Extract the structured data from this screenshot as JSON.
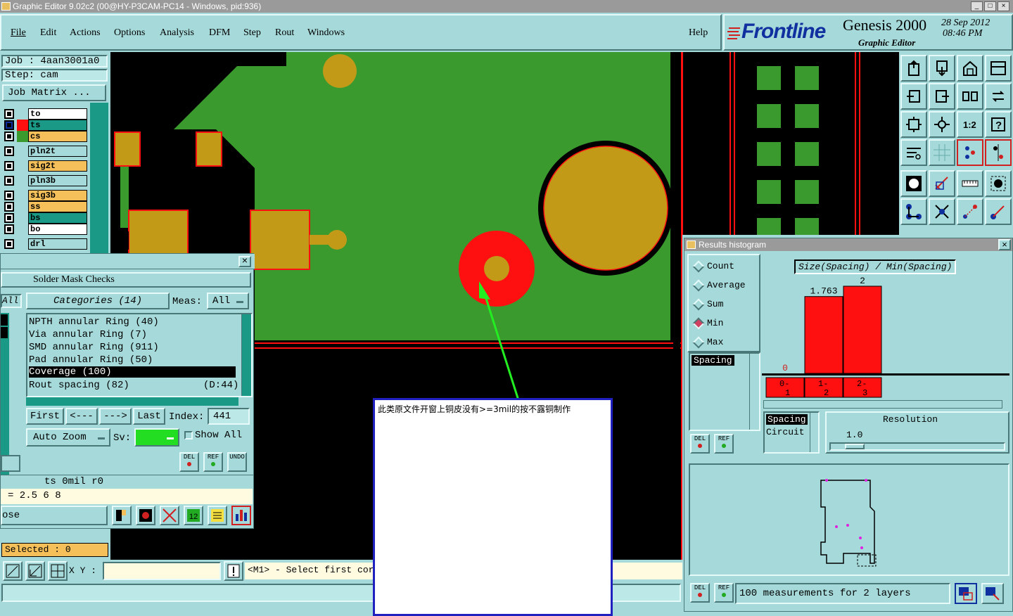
{
  "window": {
    "title": "Graphic Editor 9.02c2 (00@HY-P3CAM-PC14 - Windows, pid:936)"
  },
  "menu": {
    "items": [
      "File",
      "Edit",
      "Actions",
      "Options",
      "Analysis",
      "DFM",
      "Step",
      "Rout",
      "Windows"
    ],
    "help": "Help"
  },
  "brand": {
    "logo": "Frontline",
    "product": "Genesis 2000",
    "subtitle": "Graphic Editor",
    "date": "28 Sep 2012",
    "time": "08:46 PM"
  },
  "job": {
    "job": "Job : 4aan3001a0",
    "step": "Step: cam",
    "matrix_button": "Job Matrix ..."
  },
  "layers": [
    {
      "name": "to",
      "color": "#ffffff"
    },
    {
      "name": "ts",
      "color": "#1a9a86"
    },
    {
      "name": "cs",
      "color": "#f5c05a"
    },
    {
      "name": "pln2t",
      "color": "#a6dada"
    },
    {
      "name": "sig2t",
      "color": "#f5c05a"
    },
    {
      "name": "pln3b",
      "color": "#a6dada"
    },
    {
      "name": "sig3b",
      "color": "#f5c05a"
    },
    {
      "name": "ss",
      "color": "#f5c05a"
    },
    {
      "name": "bs",
      "color": "#1a9a86"
    },
    {
      "name": "bo",
      "color": "#ffffff"
    },
    {
      "name": "drl",
      "color": "#a6dada"
    }
  ],
  "checks": {
    "title": "Solder Mask Checks",
    "all_label": "All",
    "categories": "Categories (14)",
    "meas_label": "Meas:",
    "meas_value": "All",
    "rows": [
      {
        "text": "NPTH annular Ring (40)",
        "extra": ""
      },
      {
        "text": "Via annular Ring (7)",
        "extra": ""
      },
      {
        "text": "SMD annular Ring (911)",
        "extra": ""
      },
      {
        "text": "Pad annular Ring (50)",
        "extra": ""
      },
      {
        "text": "Coverage (100)",
        "extra": ""
      },
      {
        "text": "Rout spacing (82)",
        "extra": "(D:44)"
      }
    ],
    "first": "First",
    "prev": "<---",
    "next": "--->",
    "last": "Last",
    "index_label": "Index:",
    "index_value": "441",
    "auto_zoom": "Auto Zoom",
    "sv": "Sv:",
    "show_all": "Show All",
    "del": "DEL",
    "ref": "REF",
    "undo": "UNDO",
    "info": "ts 0mil r0",
    "values": "= 2.5 6 8",
    "close": "ose"
  },
  "selected": "Selected : 0",
  "status": {
    "xy": "X Y :",
    "prompt": "<M1> - Select first corner"
  },
  "annotation": "此类原文件开窗上铜皮没有>=3mil的按不露铜制作",
  "results": {
    "title": "Results histogram",
    "modes": [
      "Count",
      "Average",
      "Sum",
      "Min",
      "Max"
    ],
    "selected_mode": "Min",
    "list_item": "Spacing",
    "chart_title": "Size(Spacing) / Min(Spacing)",
    "resolution_label": "Resolution",
    "resolution_value": "1.0",
    "measure_types": [
      "Spacing",
      "Circuit"
    ],
    "summary": "100 measurements for 2 layers"
  },
  "chart_data": {
    "type": "bar",
    "categories": [
      "0-1",
      "1-2",
      "2-3"
    ],
    "values": [
      0,
      1.763,
      2
    ],
    "labels": [
      "0",
      "1.763",
      "2"
    ],
    "title": "Size(Spacing) / Min(Spacing)"
  },
  "colors": {
    "panel": "#a6dada",
    "board": "#3a9a2e",
    "pad": "#c29a18",
    "mark": "#ff1010",
    "teal": "#1a9a86"
  }
}
